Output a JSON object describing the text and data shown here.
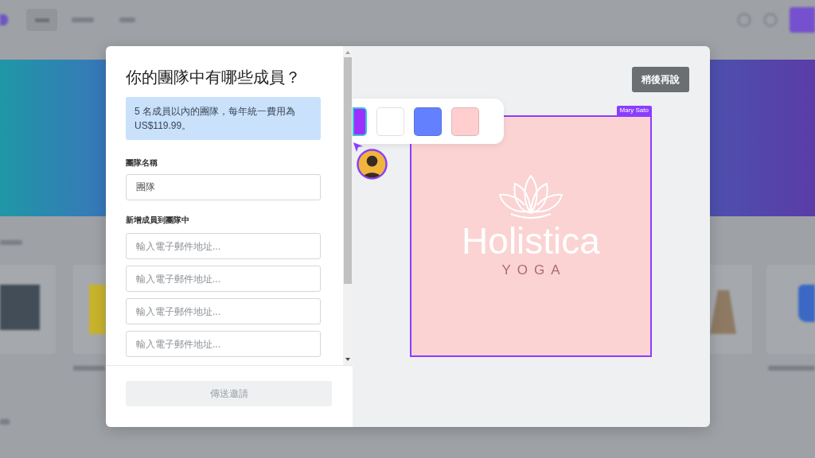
{
  "dialog": {
    "title": "你的團隊中有哪些成員？",
    "notice": "5 名成員以內的團隊，每年統一費用為 US$119.99。",
    "team_name": {
      "label": "團隊名稱",
      "value": "團隊"
    },
    "members": {
      "label": "新增成員到團隊中",
      "fields": [
        {
          "placeholder": "輸入電子郵件地址..."
        },
        {
          "placeholder": "輸入電子郵件地址..."
        },
        {
          "placeholder": "輸入電子郵件地址..."
        },
        {
          "placeholder": "輸入電子郵件地址..."
        }
      ]
    },
    "send_button": {
      "label": "傳送邀請",
      "disabled": true
    }
  },
  "preview": {
    "later_button": "稍後再說",
    "palette": [
      {
        "color": "#9b30ff",
        "selected": true
      },
      {
        "color": "#ffffff",
        "selected": false
      },
      {
        "color": "#6381ff",
        "selected": false
      },
      {
        "color": "#ffcfcf",
        "selected": false
      }
    ],
    "design": {
      "collaborator": "Mary Sato",
      "brand": "Holistica",
      "tagline": "YOGA"
    }
  }
}
